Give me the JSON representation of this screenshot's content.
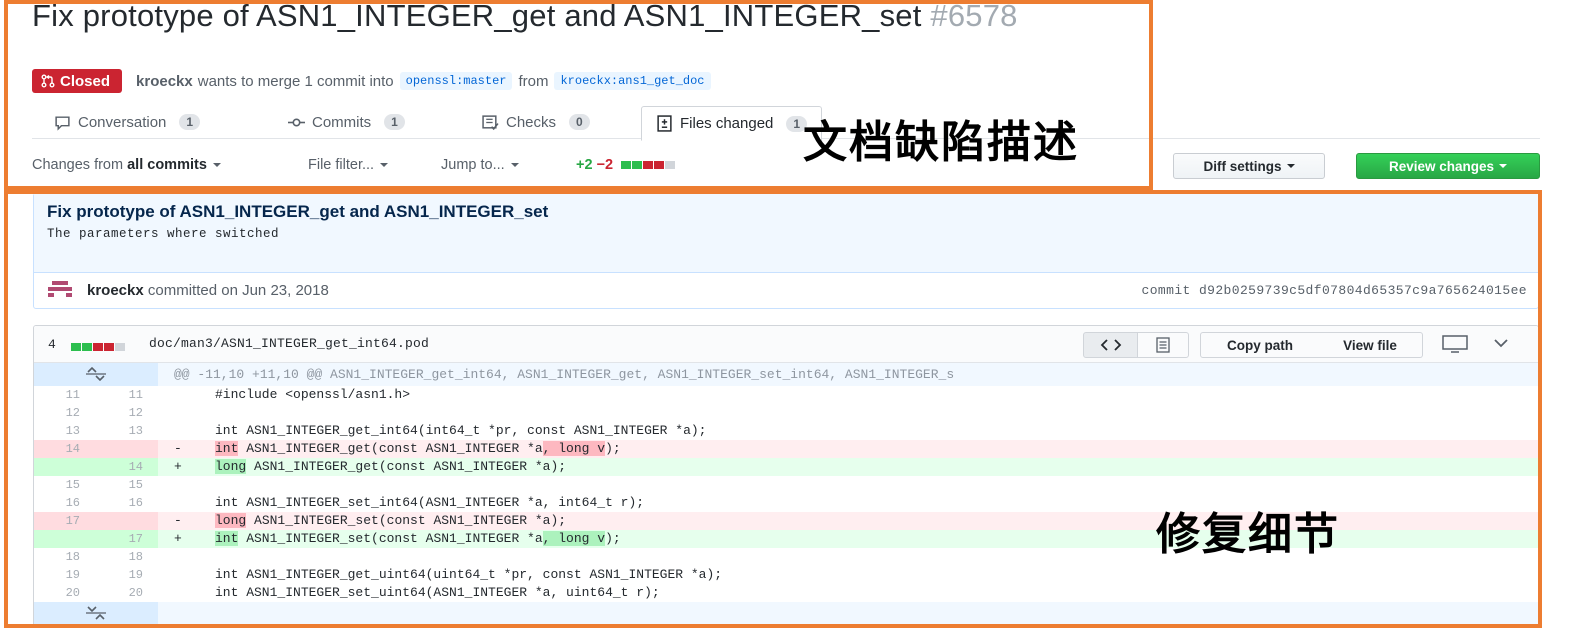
{
  "pr": {
    "title": "Fix prototype of ASN1_INTEGER_get and ASN1_INTEGER_set",
    "number": "#6578",
    "status": "Closed",
    "author": "kroeckx",
    "merge_text": "wants to merge 1 commit into",
    "base_branch": "openssl:master",
    "from_text": "from",
    "head_branch": "kroeckx:ans1_get_doc"
  },
  "tabs": [
    {
      "label": "Conversation",
      "count": "1",
      "icon": "comment-icon"
    },
    {
      "label": "Commits",
      "count": "1",
      "icon": "commit-icon"
    },
    {
      "label": "Checks",
      "count": "0",
      "icon": "checklist-icon"
    },
    {
      "label": "Files changed",
      "count": "1",
      "icon": "diff-icon"
    }
  ],
  "toolbar": {
    "changes_prefix": "Changes from",
    "changes_value": "all commits",
    "file_filter": "File filter...",
    "jump_to": "Jump to...",
    "additions": "+2",
    "deletions": "−2",
    "diff_settings": "Diff settings",
    "review_changes": "Review changes"
  },
  "commit": {
    "title": "Fix prototype of ASN1_INTEGER_get and ASN1_INTEGER_set",
    "description": "The parameters where switched",
    "author": "kroeckx",
    "committed_text": "committed on Jun 23, 2018",
    "sha_label": "commit d92b0259739c5df07804d65357c9a765624015ee"
  },
  "file": {
    "changes_count": "4",
    "path": "doc/man3/ASN1_INTEGER_get_int64.pod",
    "copy_path": "Copy path",
    "view_file": "View file",
    "hunk_header": "@@ -11,10 +11,10 @@ ASN1_INTEGER_get_int64, ASN1_INTEGER_get, ASN1_INTEGER_set_int64, ASN1_INTEGER_s",
    "lines": [
      {
        "type": "ctx",
        "old": "11",
        "new": "11",
        "sign": "",
        "code": "#include <openssl/asn1.h>"
      },
      {
        "type": "ctx",
        "old": "12",
        "new": "12",
        "sign": "",
        "code": ""
      },
      {
        "type": "ctx",
        "old": "13",
        "new": "13",
        "sign": "",
        "code": "int ASN1_INTEGER_get_int64(int64_t *pr, const ASN1_INTEGER *a);"
      },
      {
        "type": "del",
        "old": "14",
        "new": "",
        "sign": "-",
        "pre": "",
        "hl1": "int",
        "mid": " ASN1_INTEGER_get(const ASN1_INTEGER *a",
        "hl2": ", long v",
        "post": ");"
      },
      {
        "type": "add",
        "old": "",
        "new": "14",
        "sign": "+",
        "pre": "",
        "hl1": "long",
        "mid": " ASN1_INTEGER_get(const ASN1_INTEGER *a);",
        "hl2": "",
        "post": ""
      },
      {
        "type": "ctx",
        "old": "15",
        "new": "15",
        "sign": "",
        "code": ""
      },
      {
        "type": "ctx",
        "old": "16",
        "new": "16",
        "sign": "",
        "code": "int ASN1_INTEGER_set_int64(ASN1_INTEGER *a, int64_t r);"
      },
      {
        "type": "del",
        "old": "17",
        "new": "",
        "sign": "-",
        "pre": "",
        "hl1": "long",
        "mid": " ASN1_INTEGER_set(const ASN1_INTEGER *a);",
        "hl2": "",
        "post": ""
      },
      {
        "type": "add",
        "old": "",
        "new": "17",
        "sign": "+",
        "pre": "",
        "hl1": "int",
        "mid": " ASN1_INTEGER_set(const ASN1_INTEGER *a",
        "hl2": ", long v",
        "post": ");"
      },
      {
        "type": "ctx",
        "old": "18",
        "new": "18",
        "sign": "",
        "code": ""
      },
      {
        "type": "ctx",
        "old": "19",
        "new": "19",
        "sign": "",
        "code": "int ASN1_INTEGER_get_uint64(uint64_t *pr, const ASN1_INTEGER *a);"
      },
      {
        "type": "ctx",
        "old": "20",
        "new": "20",
        "sign": "",
        "code": "int ASN1_INTEGER_set_uint64(ASN1_INTEGER *a, uint64_t r);"
      }
    ]
  },
  "annotations": {
    "top_label": "文档缺陷描述",
    "bottom_label": "修复细节",
    "border_color": "#ed7d31"
  },
  "colors": {
    "closed_red": "#cb2431",
    "review_green": "#28a745",
    "del_bg": "#ffeef0",
    "add_bg": "#e6ffed"
  }
}
